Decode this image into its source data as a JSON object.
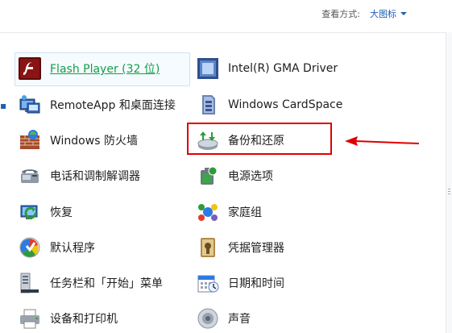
{
  "header": {
    "view_by_label": "查看方式:",
    "view_by_value": "大图标"
  },
  "items_left": [
    {
      "label": "Flash Player (32 位)",
      "icon": "flash-player-icon"
    },
    {
      "label": "RemoteApp 和桌面连接",
      "icon": "remoteapp-icon"
    },
    {
      "label": "Windows 防火墙",
      "icon": "firewall-icon"
    },
    {
      "label": "电话和调制解调器",
      "icon": "phone-modem-icon"
    },
    {
      "label": "恢复",
      "icon": "recovery-icon"
    },
    {
      "label": "默认程序",
      "icon": "default-programs-icon"
    },
    {
      "label": "任务栏和「开始」菜单",
      "icon": "taskbar-start-icon"
    },
    {
      "label": "设备和打印机",
      "icon": "printer-icon"
    }
  ],
  "items_right": [
    {
      "label": "Intel(R) GMA Driver",
      "icon": "intel-gma-icon"
    },
    {
      "label": "Windows CardSpace",
      "icon": "cardspace-icon"
    },
    {
      "label": "备份和还原",
      "icon": "backup-restore-icon"
    },
    {
      "label": "电源选项",
      "icon": "power-options-icon"
    },
    {
      "label": "家庭组",
      "icon": "homegroup-icon"
    },
    {
      "label": "凭据管理器",
      "icon": "credential-manager-icon"
    },
    {
      "label": "日期和时间",
      "icon": "date-time-icon"
    },
    {
      "label": "声音",
      "icon": "sound-icon"
    }
  ],
  "colors": {
    "link_blue": "#1e5fb5",
    "highlight_red": "#e00000",
    "flash_green": "#169d4a"
  }
}
